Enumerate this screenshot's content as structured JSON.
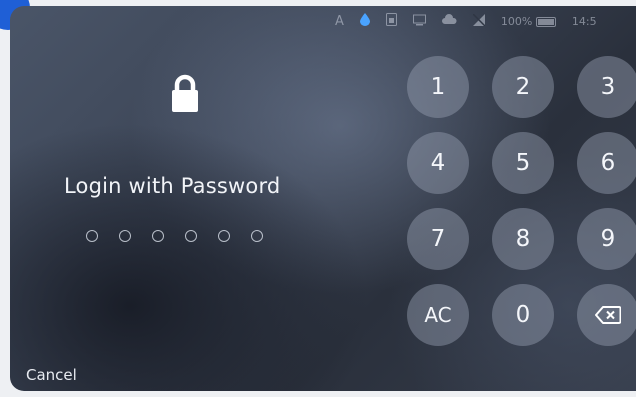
{
  "status_bar": {
    "letter": "A",
    "battery_text": "100%",
    "time": "14:5"
  },
  "login": {
    "title": "Login with Password",
    "pin_length": 6,
    "entered": 0
  },
  "keypad": {
    "rows": [
      [
        "1",
        "2",
        "3"
      ],
      [
        "4",
        "5",
        "6"
      ],
      [
        "7",
        "8",
        "9"
      ],
      [
        "AC",
        "0",
        "backspace"
      ]
    ],
    "key_1": "1",
    "key_2": "2",
    "key_3": "3",
    "key_4": "4",
    "key_5": "5",
    "key_6": "6",
    "key_7": "7",
    "key_8": "8",
    "key_9": "9",
    "key_ac": "AC",
    "key_0": "0"
  },
  "footer": {
    "cancel_label": "Cancel"
  },
  "colors": {
    "accent_badge": "#1f5fd6",
    "drop_icon": "#4aa3ff",
    "text": "#f2f4f8"
  },
  "icons": {
    "lock": "lock-icon",
    "backspace": "backspace-icon",
    "battery": "battery-icon",
    "drop": "water-drop-icon"
  }
}
